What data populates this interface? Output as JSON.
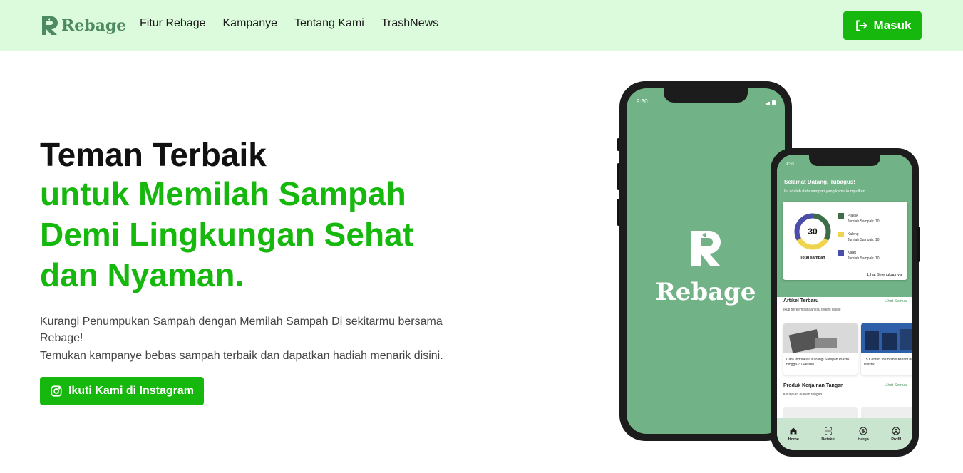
{
  "brand": {
    "name": "Rebage",
    "color": "#17b80e",
    "logo_color": "#4d8a5f"
  },
  "nav": {
    "links": [
      "Fitur Rebage",
      "Kampanye",
      "Tentang Kami",
      "TrashNews"
    ],
    "login_label": "Masuk",
    "login_icon": "sign-in-icon"
  },
  "hero": {
    "title_line1": "Teman Terbaik",
    "title_line2": "untuk Memilah Sampah",
    "title_line3": "Demi Lingkungan Sehat",
    "title_line4": "dan Nyaman.",
    "desc1": "Kurangi Penumpukan Sampah dengan Memilah Sampah Di sekitarmu bersama Rebage!",
    "desc2": "Temukan kampanye bebas sampah terbaik dan dapatkan hadiah menarik disini.",
    "cta_label": "Ikuti Kami di Instagram",
    "cta_icon": "instagram-icon"
  },
  "phone1": {
    "time": "9:30",
    "splash_text": "Rebage"
  },
  "phone2": {
    "time": "9:30",
    "greeting": "Selamat Datang, Tubagus!",
    "greeting_sub": "Ini adalah data sampah yang kamu kumpulkan",
    "chart": {
      "total": "30",
      "total_label": "Total sampah",
      "items": [
        {
          "name": "Plastik",
          "count_label": "Jumlah Sampah: 10",
          "value": 10,
          "color": "#3d6e48"
        },
        {
          "name": "Kaleng",
          "count_label": "Jumlah Sampah: 10",
          "value": 10,
          "color": "#f0d44e"
        },
        {
          "name": "Karet",
          "count_label": "Jumlah Sampah: 10",
          "value": 10,
          "color": "#4a4ea8"
        }
      ],
      "see_more": "Lihat Selengkapnya"
    },
    "articles": {
      "title": "Artikel Terbaru",
      "link": "Lihat Semua",
      "sub": "Ikuti perkembangan isu terkini disini!",
      "items": [
        "Cara Indonesia Kurangi Sampah Plastik hingga 70 Persen",
        "15 Contoh Ide Bisnis Kreatif dari Limbah Plastik"
      ]
    },
    "products": {
      "title": "Produk Kerjainan Tangan",
      "link": "Lihat Semua",
      "sub": "Kerajinan olahan tangan"
    },
    "bottom_nav": [
      "Home",
      "Deteksi",
      "Harga",
      "Profil"
    ]
  }
}
